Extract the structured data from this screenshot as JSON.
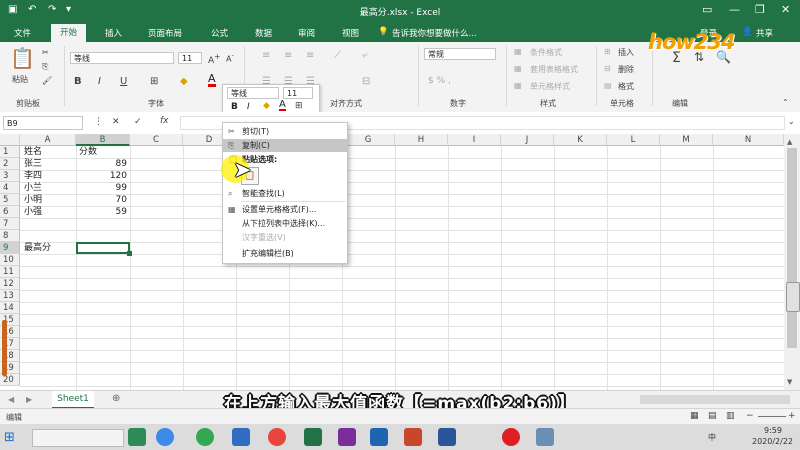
{
  "window": {
    "title": "最高分.xlsx - Excel"
  },
  "tabs": [
    "文件",
    "开始",
    "插入",
    "页面布局",
    "公式",
    "数据",
    "审阅",
    "视图"
  ],
  "tell_me": "告诉我你想要做什么...",
  "user": {
    "login": "登录",
    "share": "共享"
  },
  "ribbon": {
    "paste": "粘贴",
    "clipboard_label": "剪贴板",
    "font_name": "等线",
    "font_size": "11",
    "font_label": "字体",
    "align_label": "对齐方式",
    "number_format": "常规",
    "number_label": "数字",
    "cond_format": "条件格式",
    "table_format": "套用表格格式",
    "cell_style": "单元格样式",
    "styles_label": "样式",
    "insert": "插入",
    "delete": "删除",
    "format": "格式",
    "cells_label": "单元格",
    "edit_label": "编辑"
  },
  "formula_bar": {
    "name_box": "B9",
    "fx": "fx"
  },
  "grid": {
    "columns": [
      "A",
      "B",
      "C",
      "D",
      "E",
      "F",
      "G",
      "H",
      "I",
      "J",
      "K",
      "L",
      "M",
      "N"
    ],
    "rows": [
      "1",
      "2",
      "3",
      "4",
      "5",
      "6",
      "7",
      "8",
      "9",
      "10",
      "11",
      "12",
      "13",
      "14",
      "15",
      "16",
      "17",
      "18",
      "19",
      "20"
    ],
    "cells": {
      "a1": "姓名",
      "b1": "分数",
      "a2": "张三",
      "b2": "89",
      "a3": "李四",
      "b3": "120",
      "a4": "小兰",
      "b4": "99",
      "a5": "小明",
      "b5": "70",
      "a6": "小强",
      "b6": "59",
      "a9": "最高分"
    }
  },
  "mini_toolbar": {
    "font": "等线",
    "size": "11",
    "bold": "B",
    "italic": "I"
  },
  "context_menu": {
    "items": [
      "剪切(T)",
      "复制(C)",
      "粘贴选项:",
      "智能查找(L)",
      "设置单元格格式(F)...",
      "从下拉列表中选择(K)...",
      "汉字重选(V)",
      "扩充编辑栏(B)"
    ]
  },
  "sheet_tab": "Sheet1",
  "status": {
    "mode": "编辑"
  },
  "caption": "在上方输入最大值函数【=max(b2:b6)】",
  "watermark": "how234",
  "clock": {
    "time": "9:59",
    "date": "2020/2/22"
  },
  "colors": {
    "excel_green": "#217346",
    "selection": "#217346"
  }
}
